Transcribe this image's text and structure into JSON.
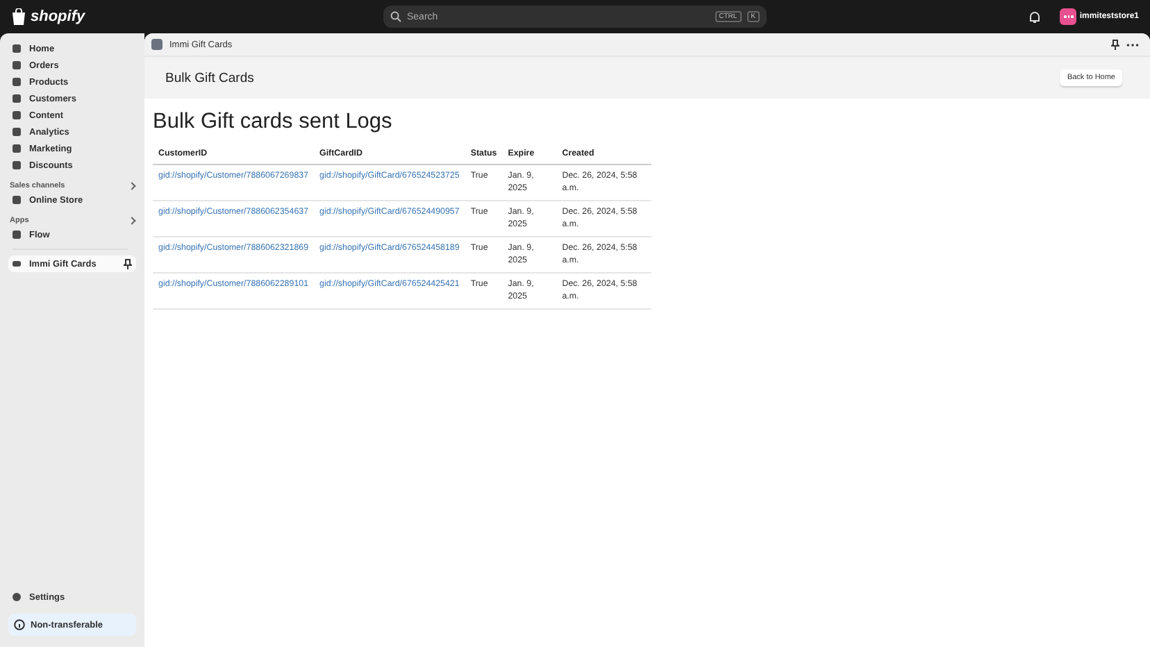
{
  "topbar": {
    "logo": "shopify",
    "search": {
      "placeholder": "Search",
      "keys": [
        "CTRL",
        "K"
      ]
    },
    "store": "immiteststore1"
  },
  "sidebar": {
    "items": [
      {
        "label": "Home",
        "selected": false
      },
      {
        "label": "Orders",
        "selected": false
      },
      {
        "label": "Products",
        "selected": false
      },
      {
        "label": "Customers",
        "selected": false
      },
      {
        "label": "Content",
        "selected": false
      },
      {
        "label": "Analytics",
        "selected": false
      },
      {
        "label": "Marketing",
        "selected": false
      },
      {
        "label": "Discounts",
        "selected": false
      }
    ],
    "sales_channels": {
      "title": "Sales channels",
      "items": [
        {
          "label": "Online Store",
          "selected": false
        }
      ]
    },
    "apps": {
      "title": "Apps",
      "items": [
        {
          "label": "Flow",
          "selected": false
        }
      ]
    },
    "app_pinned": {
      "label": "Immi Gift Cards",
      "selected": true
    },
    "settings": "Settings",
    "notice": "Non-transferable"
  },
  "app_bar": {
    "title": "Immi Gift Cards"
  },
  "title_bar": {
    "title": "Bulk Gift Cards",
    "button": "Back to Home"
  },
  "page": {
    "heading": "Bulk Gift cards sent Logs",
    "table": {
      "columns": [
        "CustomerID",
        "GiftCardID",
        "Status",
        "Expire",
        "Created"
      ],
      "rows": [
        [
          "gid://shopify/Customer/7886067269837",
          "gid://shopify/GiftCard/676524523725",
          "True",
          "Jan. 9, 2025",
          "Dec. 26, 2024, 5:58 a.m."
        ],
        [
          "gid://shopify/Customer/7886062354637",
          "gid://shopify/GiftCard/676524490957",
          "True",
          "Jan. 9, 2025",
          "Dec. 26, 2024, 5:58 a.m."
        ],
        [
          "gid://shopify/Customer/7886062321869",
          "gid://shopify/GiftCard/676524458189",
          "True",
          "Jan. 9, 2025",
          "Dec. 26, 2024, 5:58 a.m."
        ],
        [
          "gid://shopify/Customer/7886062289101",
          "gid://shopify/GiftCard/676524425421",
          "True",
          "Jan. 9, 2025",
          "Dec. 26, 2024, 5:58 a.m."
        ]
      ]
    }
  }
}
